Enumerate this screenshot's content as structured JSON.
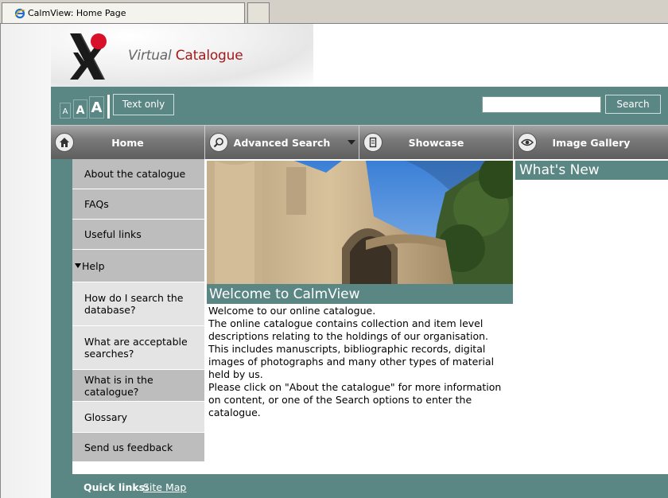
{
  "browser": {
    "tab_title": "CalmView: Home Page"
  },
  "header": {
    "logo_virtual": "Virtual",
    "logo_catalogue": "Catalogue"
  },
  "toolbar": {
    "font_small": "A",
    "font_medium": "A",
    "font_large": "A",
    "text_only_label": "Text only",
    "search_value": "",
    "search_button": "Search"
  },
  "nav": {
    "home": "Home",
    "advanced_search": "Advanced Search",
    "showcase": "Showcase",
    "image_gallery": "Image Gallery"
  },
  "sidebar": {
    "items": [
      {
        "label": "About the catalogue"
      },
      {
        "label": "FAQs"
      },
      {
        "label": "Useful links"
      },
      {
        "label": "Help"
      },
      {
        "label": "How do I search the database?"
      },
      {
        "label": "What are acceptable searches?"
      },
      {
        "label": "What is in the catalogue?"
      },
      {
        "label": "Glossary"
      },
      {
        "label": "Send us feedback"
      }
    ]
  },
  "main": {
    "welcome_title": "Welcome to CalmView",
    "welcome_lines": [
      "Welcome to our online catalogue.",
      "The online catalogue contains collection and item level descriptions relating to the holdings of our organisation.",
      "This includes manuscripts, bibliographic records, digital images of photographs and many other types of material held by us.",
      "Please click on \"About the catalogue\" for more information on content, or one of the Search options to enter the catalogue."
    ]
  },
  "right": {
    "whats_new_title": "What's New"
  },
  "footer": {
    "quick_links_label": "Quick links:",
    "site_map": "Site Map"
  },
  "colors": {
    "teal": "#5a8683",
    "logo_red": "#d8102a",
    "nav_grey": "#7a7a7a"
  }
}
